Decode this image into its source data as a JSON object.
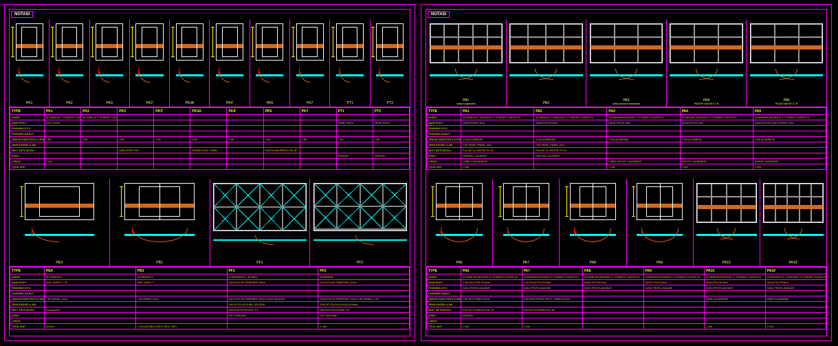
{
  "title": "NOTASI",
  "left": {
    "top": {
      "cells": [
        {
          "code": "PK1",
          "sub": ""
        },
        {
          "code": "PK2",
          "sub": ""
        },
        {
          "code": "PK3",
          "sub": ""
        },
        {
          "code": "PK3'",
          "sub": ""
        },
        {
          "code": "PK3A",
          "sub": ""
        },
        {
          "code": "PK4'",
          "sub": ""
        },
        {
          "code": "PK6",
          "sub": ""
        },
        {
          "code": "PK7",
          "sub": ""
        },
        {
          "code": "PT1",
          "sub": ""
        },
        {
          "code": "PT2",
          "sub": ""
        }
      ],
      "rows": [
        "TYPE",
        "KUSEN",
        "DAUN PINTU",
        "FINISHING D.P.U",
        "FINISHING DAUN P",
        "JUMLAH DAUN PINTU & JENISNYA",
        "JENIS ENGSEL & JML",
        "NEXT. METICA/CELL",
        "KUNCI",
        "LOKASI",
        "TOTAL UNIT"
      ],
      "data": [
        [
          "PK1",
          "PK2",
          "PK3",
          "PK3'",
          "PK3A",
          "PK4'",
          "PK6",
          "PK7",
          "PT1",
          "PT2"
        ],
        [
          "ALUMINIUM 3\" POWDER COATED EX.",
          "ALUMINIUM 3\" POWDER COATED EX.",
          "",
          "",
          "",
          "",
          "",
          "",
          "",
          ""
        ],
        [
          "ENG. DOOR",
          "",
          "",
          "",
          "",
          "",
          "",
          "",
          "PANEL PINTU",
          "PANEL PINTU"
        ],
        [
          "-",
          "-",
          "-",
          "-",
          "-",
          "-",
          "-",
          "-",
          "-",
          "-"
        ],
        [
          "",
          "",
          "",
          "",
          "",
          "",
          "",
          "",
          "",
          ""
        ],
        [
          "1 BH",
          "1 BH",
          "1 BH",
          "1 BH",
          "1 BH",
          "1 BH",
          "1 BH",
          "1 BH",
          "1 BH",
          "1 BH"
        ],
        [
          "",
          "",
          "",
          "",
          "",
          "",
          "",
          "",
          "",
          ""
        ],
        [
          "",
          "",
          "DARU PROF PSP",
          "",
          "ENGSEL PACK, PANEL",
          "",
          "KUNCILAMA PROFIL PSL DP",
          "",
          "",
          ""
        ],
        [
          "",
          "",
          "",
          "",
          "",
          "",
          "",
          "",
          "DEKSON",
          "DEKSON"
        ],
        [
          "1 Unit",
          "",
          "",
          "",
          "",
          "",
          "",
          "",
          "",
          ""
        ],
        [
          "",
          "",
          "",
          "",
          "",
          "",
          "",
          "",
          "",
          ""
        ]
      ]
    },
    "bot": {
      "cells": [
        {
          "code": "PEX",
          "sub": "",
          "type": "door"
        },
        {
          "code": "PB1",
          "sub": "",
          "type": "dbldoor"
        },
        {
          "code": "PF1",
          "sub": "",
          "type": "curtain"
        },
        {
          "code": "PF2",
          "sub": "",
          "type": "curtain6"
        }
      ],
      "rows": [
        "TYPE",
        "KUSEN",
        "DAUN PINTU",
        "FINISHING D.P.U",
        "FINISHING DAUN P",
        "JUMLAH DAUN PINTU & JENISNYA",
        "JENIS ENGSEL & JML",
        "NEXT. METICA/CELL",
        "KUNCI",
        "LOKASI",
        "TOTAL UNIT"
      ],
      "data": [
        [
          "PEX",
          "PB1",
          "PF1",
          "PF2"
        ],
        [
          "ALUMINIUM 4\"",
          "ALUMINIUM 4\"",
          "ALUMINIUM EX. JETINDO",
          "ALUMINIUM"
        ],
        [
          "ENG. DOOR / T. JR",
          "ENG. DOOR / T",
          "KACA POLOS TEMPERED 10mm",
          "KACA POLOS TEMPERED 10mm"
        ],
        [
          "-",
          "-",
          "-",
          "-"
        ],
        [
          "",
          "",
          "",
          ""
        ],
        [
          "1 BH (PANEL 1mm)",
          "1 BH (PANEL 1mm)",
          "KACA POLOS TEMPERED 10mm & 8mm SEALANT",
          "KACA POLOS TEMPERED 10mm 2.3m (PANEL) 1.3m"
        ],
        [
          "",
          "",
          ">BH 4P POLOS 8 MM /.200 SEAL",
          "2-BH 4P POLOS (8 8 KACA 10mm)"
        ],
        [
          "B Equipment",
          "",
          "DEKSON PROFIL/HZE. PS",
          "DEKSON PROFIL/HZE. PS"
        ],
        [
          "",
          "",
          "EXIT DORGANT",
          "EXIT DORGANT"
        ],
        [
          "",
          "",
          "",
          ""
        ],
        [
          "18 Unit",
          "7 Unit (DOUBLE,JDM 4 PINTU JNP)",
          "",
          "1 Unit"
        ]
      ]
    }
  },
  "right": {
    "top": {
      "cells": [
        {
          "code": "PA1",
          "sub": "lobby lt.basement",
          "type": "store5"
        },
        {
          "code": "PA2",
          "sub": "",
          "type": "store4"
        },
        {
          "code": "PA3",
          "sub": "lobby service lt.basement",
          "type": "store3"
        },
        {
          "code": "PA4",
          "sub": "PASTRY DAPUR LT. B",
          "type": "store3"
        },
        {
          "code": "PA5",
          "sub": "PICED DAPUR LT. B",
          "type": "store3"
        }
      ],
      "rows": [
        "TYPE",
        "KUSEN",
        "DAUN PINTU",
        "FINISHING D.P.U",
        "FINISHING DAUN P",
        "JUMLAH DAUN PINTU & JENISNYA",
        "JENIS ENGSEL & JML",
        "NEXT. METICA/CELL",
        "KUNCI",
        "LOKASI",
        "TOTAL UNIT"
      ],
      "data": [
        [
          "PA1",
          "PA2",
          "PA3",
          "PA4",
          "PA5"
        ],
        [
          "ALUMINIUM 4\" ANODIZED 4\" POWDER COATED EX.",
          "ALUMINIUM 4\" ANODIZED 4\" POWDER COATED EX.",
          "ALUMINIUM ANODIZED 4\" POWDER COATED EX.",
          "ALUMINIUM ANODIZED 4\" POWDER COATED EX.",
          "ALUMINIUM ANODIZED 4\" POWDER COATED EX."
        ],
        [
          "DAUN PROFIL 1mm",
          "DAUN POLOS 1mm",
          "DAUN POLOS 1mm",
          "KACA POLOS 1mm",
          "DAUN POLOS 1mm & PROFIL 1mm"
        ],
        [
          "-",
          "-",
          "-",
          "-",
          "-"
        ],
        [
          "",
          "",
          "",
          "",
          ""
        ],
        [
          "2-DM ALUMINIUM",
          "2-DM ALUMINIUM",
          "2-DM ALUMINIUM",
          "2-DM ALUMINIUM",
          "2-DM ALUMINIUM"
        ],
        [
          "2 BH PANEL+PANEL 1mm",
          "2 BH PANEL+PANEL 1mm",
          "",
          "",
          ""
        ],
        [
          "PULLED CLOSE/PSL PS 26",
          "PULLED CLOSE/PSL PS 26",
          "",
          "",
          ""
        ],
        [
          "DEKSON 1 SILINDER",
          "DEKSON 1 SILINDER",
          "",
          "",
          ""
        ],
        [
          "LOBBY LT.BASEMENT",
          "",
          "LOBBY SEVICE 1 BASEMENT",
          "PASTRY 1 BASEMENT",
          "DAPUR 1 BASEMENT"
        ],
        [
          "1 Unit",
          "",
          "1 Unit",
          "1 Unit",
          "1 Unit"
        ]
      ]
    },
    "bot": {
      "cells": [
        {
          "code": "PA6",
          "sub": "",
          "type": "dbldoor"
        },
        {
          "code": "PA7",
          "sub": "",
          "type": "dbldoor"
        },
        {
          "code": "PA8",
          "sub": "",
          "type": "dbldoor"
        },
        {
          "code": "PA9",
          "sub": "",
          "type": "dbldoor"
        },
        {
          "code": "PA10",
          "sub": "",
          "type": "store4"
        },
        {
          "code": "PA10'",
          "sub": "",
          "type": "store5"
        }
      ],
      "rows": [
        "TYPE",
        "KUSEN",
        "DAUN PINTU",
        "FINISHING D.P.U",
        "FINISHING DAUN P",
        "JUMLAH DAUN PINTU & JENISNYA",
        "JENIS ENGSEL & JML",
        "NEXT. METICA/CELL",
        "KUNCI",
        "LOKASI",
        "TOTAL UNIT"
      ],
      "data": [
        [
          "PA6",
          "PA7",
          "PA8",
          "PA9",
          "PA10",
          "PA10'"
        ],
        [
          "ALUMINIUM ANODIZED 4\" POWDER COATED EX.",
          "ALUMINIUM ANODIZED 4\" POWDER COATED EX.",
          "ALUMINIUM ANODIZED 4\" POWDER COATED EX.",
          "ALUMINIUM ANODIZED 4\" POWDER COATED EX.",
          "ALUMINIUM ANODIZED 4\" POWDER COATED EX.",
          "ALUMINIUM DC 4\"/ANODIZE 4\" POWDER COATED EX."
        ],
        [
          "2 DN KACA POLOS 8mm",
          "2 DN KACA POLOS 8mm",
          "DAUN POLOS 8mm",
          "DAUN POLOS 8mm",
          "DAUN POLOS 8mm",
          "DAUN POLOS 8mm"
        ],
        [
          "DUKU PROFIL ANODIZE",
          "DUKU PROFIL ANODIZE",
          "DUKU PROFIL ANODIZE",
          "DUKU PROFIL ANODIZE",
          "DUKU PROFIL ANODIZE",
          "DUKU PROFIL ANODIZE"
        ],
        [
          "",
          "",
          "",
          "",
          "",
          ""
        ],
        [
          "2 BH AKA .PANEL KOCA",
          "2-BH 8 BH PROFIL PIVOT 1 WING ALCAN",
          "",
          "",
          "PANEL ALUMINIUM",
          "PANEL ALUMINIUM"
        ],
        [
          "",
          "",
          "",
          "",
          "",
          ""
        ],
        [
          "PULLED CLOSE/NO PSL 26",
          "PULLED CLOSE/NO PSL 26",
          "",
          "",
          "",
          ""
        ],
        [
          "DEKSON",
          "",
          "",
          "",
          "",
          ""
        ],
        [
          "",
          "",
          "",
          "",
          "",
          ""
        ],
        [
          "1 Unit",
          "1 Unit",
          "",
          "",
          "1 Unit",
          "1 Unit"
        ]
      ]
    }
  }
}
